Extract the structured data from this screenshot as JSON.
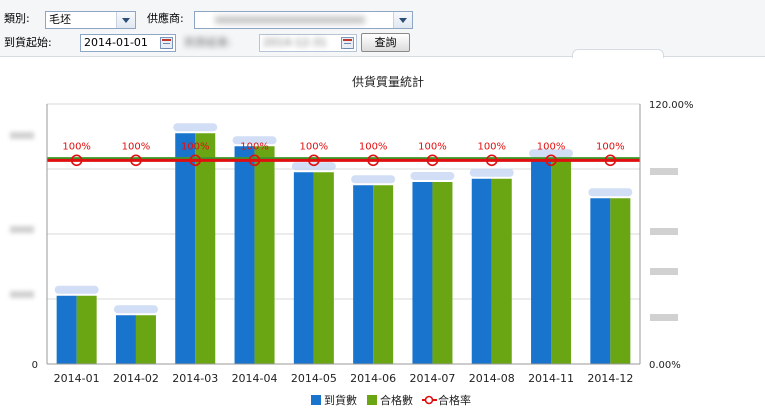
{
  "filters": {
    "category_label": "類別:",
    "category_value": "毛坯",
    "supplier_label": "供應商:",
    "supplier_value": "",
    "start_label": "到貨起始:",
    "start_value": "2014-01-01",
    "end_label": "到貨結束:",
    "end_value": "2014-12-31",
    "query_button": "查詢"
  },
  "chart_data": {
    "type": "bar",
    "title": "供貨質量統計",
    "categories": [
      "2014-01",
      "2014-02",
      "2014-03",
      "2014-04",
      "2014-05",
      "2014-06",
      "2014-07",
      "2014-08",
      "2014-11",
      "2014-12"
    ],
    "series": [
      {
        "name": "到貨數",
        "values": [
          21,
          15,
          71,
          67,
          59,
          55,
          56,
          57,
          63,
          51
        ],
        "color": "#1874cd"
      },
      {
        "name": "合格數",
        "values": [
          21,
          15,
          71,
          67,
          59,
          55,
          56,
          57,
          63,
          51
        ],
        "color": "#6aa514"
      }
    ],
    "rate_series": {
      "name": "合格率",
      "values": [
        100,
        100,
        100,
        100,
        100,
        100,
        100,
        100,
        100,
        100
      ],
      "label": "100%",
      "color": "#e01010"
    },
    "left_axis": {
      "min": 0,
      "max": 80,
      "labels": [
        "0"
      ]
    },
    "right_axis": {
      "min": 0,
      "max": 120,
      "labels": [
        "0.00%",
        "120.00%"
      ]
    },
    "reference_line": {
      "value": 95,
      "color": "#3a9a2a"
    },
    "legend": [
      "到貨數",
      "合格數",
      "合格率"
    ],
    "legend_position": "bottom",
    "grid": true
  }
}
